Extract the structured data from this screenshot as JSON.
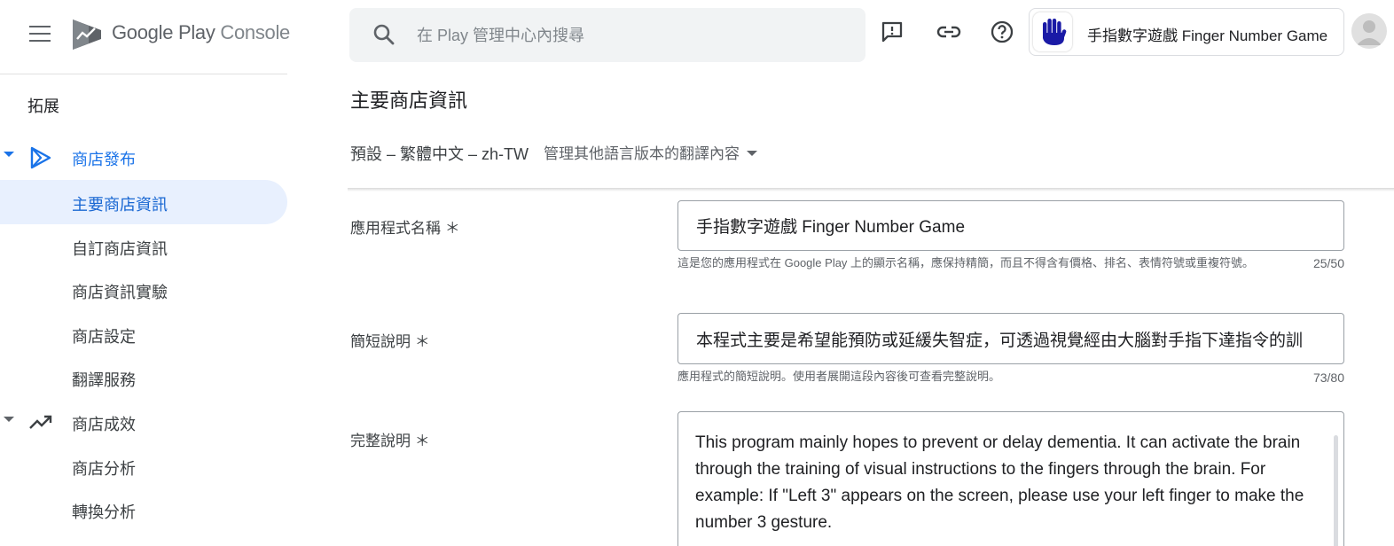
{
  "brand": {
    "google_play": "Google Play",
    "console": "Console"
  },
  "sidebar": {
    "section_title": "拓展",
    "groups": [
      {
        "label": "商店發布",
        "expanded": true,
        "items": [
          "主要商店資訊",
          "自訂商店資訊",
          "商店資訊實驗",
          "商店設定",
          "翻譯服務"
        ]
      },
      {
        "label": "商店成效",
        "expanded": true,
        "items": [
          "商店分析",
          "轉換分析"
        ]
      }
    ],
    "selected_item": "主要商店資訊"
  },
  "topbar": {
    "search_placeholder": "在 Play 管理中心內搜尋",
    "icons": [
      "search-icon",
      "feedback-icon",
      "link-icon",
      "help-icon"
    ],
    "app_name": "手指數字遊戲 Finger Number Game"
  },
  "main": {
    "title": "主要商店資訊",
    "language_default": "預設 – 繁體中文 – zh-TW",
    "manage_translations": "管理其他語言版本的翻譯內容",
    "fields": {
      "app_name": {
        "label": "應用程式名稱 ＊",
        "value": "手指數字遊戲 Finger Number Game",
        "helper": "這是您的應用程式在 Google Play 上的顯示名稱，應保持精簡，而且不得含有價格、排名、表情符號或重複符號。",
        "counter": "25/50"
      },
      "short_description": {
        "label": "簡短說明 ＊",
        "value": "本程式主要是希望能預防或延緩失智症，可透過視覺經由大腦對手指下達指令的訓",
        "helper": "應用程式的簡短說明。使用者展開這段內容後可查看完整說明。",
        "counter": "73/80"
      },
      "full_description": {
        "label": "完整說明 ＊",
        "value": "This program mainly hopes to prevent or delay dementia. It can activate the brain through the training of visual instructions to the fingers through the brain. For example: If \"Left 3\" appears on the screen, please use your left finger to make the number 3 gesture."
      }
    }
  },
  "colors": {
    "accent": "#1a73e8",
    "selected_bg": "#e8f0fe",
    "app_icon": "#1a1aa6"
  }
}
